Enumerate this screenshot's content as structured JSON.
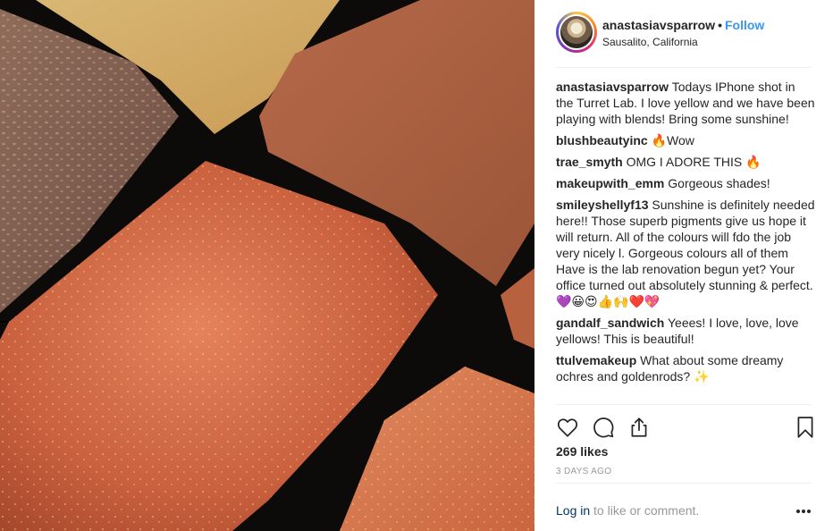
{
  "post": {
    "username": "anastasiavsparrow",
    "separator": "•",
    "follow_label": "Follow",
    "location": "Sausalito, California",
    "likes": "269 likes",
    "time": "3 DAYS AGO",
    "login_link": "Log in",
    "login_rest": " to like or comment."
  },
  "comments": [
    {
      "user": "anastasiavsparrow",
      "text": "Todays IPhone shot in the Turret Lab. I love yellow and we have been playing with blends! Bring some sunshine!"
    },
    {
      "user": "blushbeautyinc",
      "text": "🔥Wow"
    },
    {
      "user": "trae_smyth",
      "text": "OMG I ADORE THIS 🔥"
    },
    {
      "user": "makeupwith_emm",
      "text": "Gorgeous shades!"
    },
    {
      "user": "smileyshellyf13",
      "text": "Sunshine is definitely needed here!! Those superb pigments give us hope it will return. All of the colours will fdo the job very nicely l. Gorgeous colours all of them Have is the lab renovation begun yet? Your office turned out absolutely stunning & perfect. 💜😀😍👍🙌❤️💖"
    },
    {
      "user": "gandalf_sandwich",
      "text": "Yeees! I love, love, love yellows! This is beautiful!"
    },
    {
      "user": "ttulvemakeup",
      "text": "What about some dreamy ochres and goldenrods? ✨"
    }
  ],
  "icons": {
    "like": "heart-icon",
    "comment": "comment-icon",
    "share": "share-icon",
    "save": "bookmark-icon",
    "more": "more-options-icon"
  },
  "colors": {
    "link": "#3897f0",
    "muted": "#999999"
  }
}
